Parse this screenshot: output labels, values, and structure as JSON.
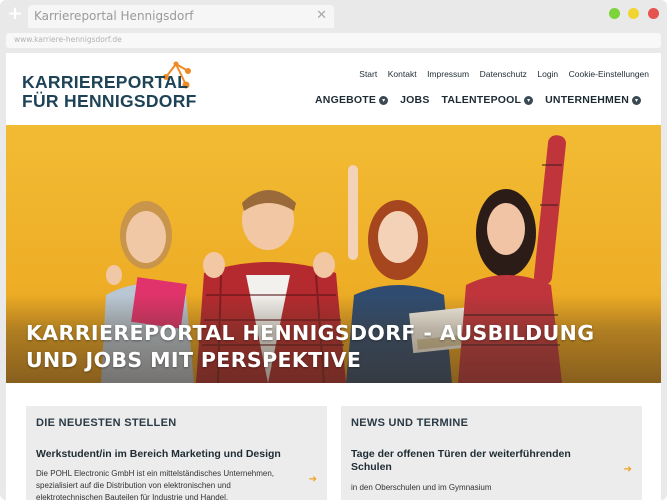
{
  "browser": {
    "tab_title": "Karriereportal Hennigsdorf",
    "url": "www.karriere-hennigsdorf.de",
    "new_tab": "+",
    "close": "✕",
    "window_buttons": [
      "#7ed23a",
      "#f0d530",
      "#e5544f"
    ]
  },
  "header": {
    "logo_line1": "KARRIEREPORTAL",
    "logo_line2": "FÜR HENNIGSDORF",
    "logo_colors": {
      "text": "#1e4357",
      "accent": "#f08a24"
    },
    "topnav": [
      "Start",
      "Kontakt",
      "Impressum",
      "Datenschutz",
      "Login",
      "Cookie-Einstellungen"
    ],
    "mainnav": [
      {
        "label": "ANGEBOTE",
        "has_dropdown": true
      },
      {
        "label": "JOBS",
        "has_dropdown": false
      },
      {
        "label": "TALENTEPOOL",
        "has_dropdown": true
      },
      {
        "label": "UNTERNEHMEN",
        "has_dropdown": true
      }
    ]
  },
  "hero": {
    "title_line1": "KARRIEREPORTAL HENNIGSDORF - AUSBILDUNG",
    "title_line2": "UND JOBS MIT PERSPEKTIVE",
    "background": "#f0b22c"
  },
  "cards": {
    "jobs": {
      "heading": "DIE NEUESTEN STELLEN",
      "title": "Werkstudent/in im Bereich Marketing und Design",
      "text_line1": "Die POHL Electronic GmbH ist ein mittelständisches Unternehmen,",
      "text_line2": "spezialisiert auf die Distribution von elektronischen und",
      "text_line3": "elektrotechnischen Bauteilen für Industrie und Handel."
    },
    "news": {
      "heading": "NEWS UND TERMINE",
      "title": "Tage der offenen Türen der weiterführenden Schulen",
      "text_line1": "in den Oberschulen und im Gymnasium"
    },
    "arrow": "➔"
  }
}
